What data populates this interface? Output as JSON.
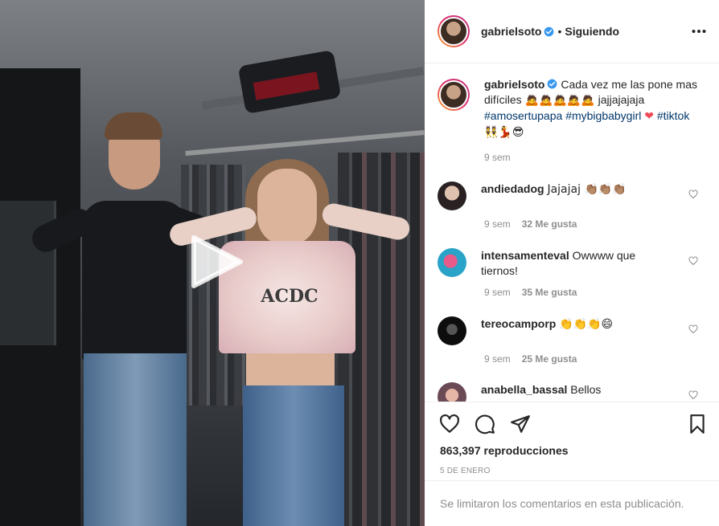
{
  "post": {
    "username": "gabrielsoto",
    "follow_status": "Siguiendo",
    "separator": "•",
    "more_icon": "more-horizontal-icon",
    "caption_text": "Cada vez me las pone mas difíciles",
    "caption_emojis": "🙇🙇🙇🙇🙇",
    "caption_laugh": "jajjajajaja",
    "hashtags": [
      "#amosertupapa",
      "#mybigbabygirl",
      "#tiktok"
    ],
    "heart_emoji": "❤",
    "trailing_emojis": "👯💃😎",
    "caption_time": "9 sem"
  },
  "comments": [
    {
      "username": "andiedadog",
      "text": "Jajajaj 👏🏽👏🏽👏🏽",
      "time": "9 sem",
      "likes": "32 Me gusta"
    },
    {
      "username": "intensamenteval",
      "text": "Owwww que tiernos!",
      "time": "9 sem",
      "likes": "35 Me gusta"
    },
    {
      "username": "tereocamporp",
      "text": "👏👏👏😄",
      "time": "9 sem",
      "likes": "25 Me gusta"
    },
    {
      "username": "anabella_bassal",
      "text": "Bellos",
      "time": "",
      "likes": ""
    }
  ],
  "actions": {
    "icons": [
      "heart-icon",
      "comment-icon",
      "share-icon",
      "bookmark-icon"
    ],
    "views": "863,397 reproducciones",
    "date": "5 DE ENERO"
  },
  "footer": {
    "comments_limited": "Se limitaron los comentarios en esta publicación."
  },
  "video": {
    "play_icon": "play-icon",
    "shirt_text": "ACDC"
  },
  "colors": {
    "accent_blue": "#3897f0",
    "hashtag": "#00376b",
    "muted": "#8e8e8e",
    "heart_red": "#ed4956"
  }
}
